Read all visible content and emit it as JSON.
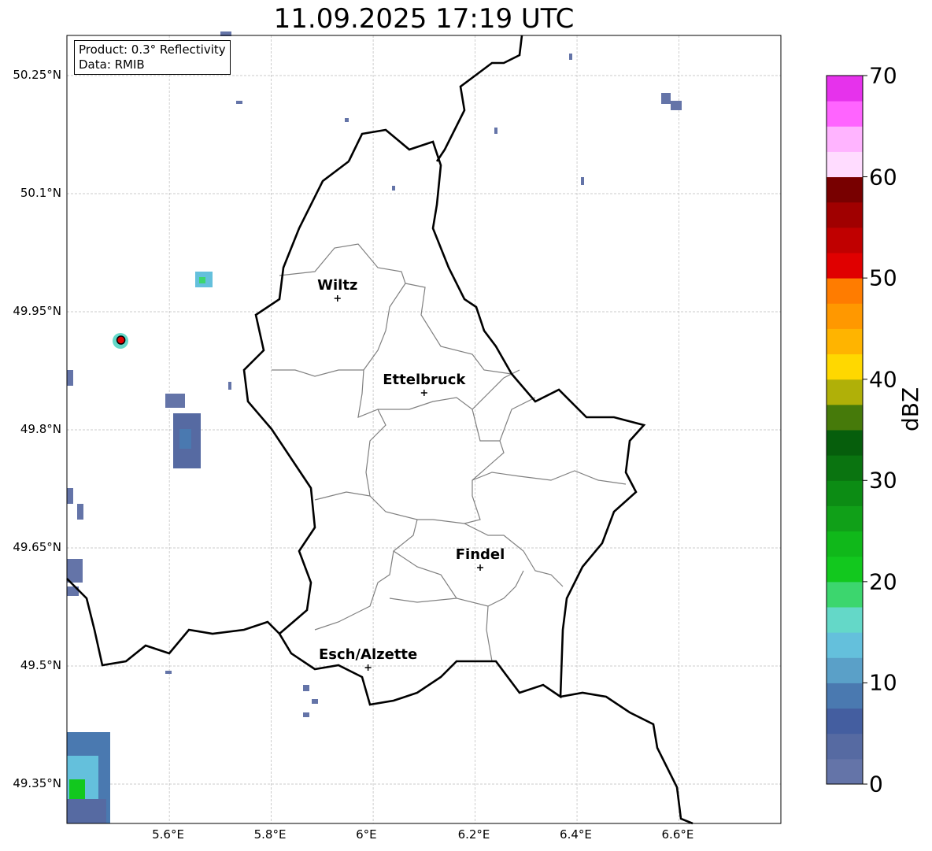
{
  "title": "11.09.2025 17:19 UTC",
  "info": {
    "product": "Product: 0.3° Reflectivity",
    "data": "Data: RMIB"
  },
  "lon_ticks": [
    {
      "v": 5.6,
      "label": "5.6°E"
    },
    {
      "v": 5.8,
      "label": "5.8°E"
    },
    {
      "v": 6.0,
      "label": "6°E"
    },
    {
      "v": 6.2,
      "label": "6.2°E"
    },
    {
      "v": 6.4,
      "label": "6.4°E"
    },
    {
      "v": 6.6,
      "label": "6.6°E"
    }
  ],
  "lat_ticks": [
    {
      "v": 50.25,
      "label": "50.25°N"
    },
    {
      "v": 50.1,
      "label": "50.1°N"
    },
    {
      "v": 49.95,
      "label": "49.95°N"
    },
    {
      "v": 49.8,
      "label": "49.8°N"
    },
    {
      "v": 49.65,
      "label": "49.65°N"
    },
    {
      "v": 49.5,
      "label": "49.5°N"
    },
    {
      "v": 49.35,
      "label": "49.35°N"
    }
  ],
  "extent": {
    "lon": [
      5.399,
      6.8
    ],
    "lat": [
      49.3,
      50.301
    ]
  },
  "cities": [
    {
      "name": "Wiltz",
      "lon": 5.93,
      "lat": 49.967
    },
    {
      "name": "Ettelbruck",
      "lon": 6.1,
      "lat": 49.847
    },
    {
      "name": "Findel",
      "lon": 6.21,
      "lat": 49.625
    },
    {
      "name": "Esch/Alzette",
      "lon": 5.99,
      "lat": 49.498
    }
  ],
  "radar_site": {
    "lon": 5.505,
    "lat": 49.914
  },
  "colorbar": {
    "label": "dBZ",
    "min": 0,
    "max": 70,
    "ticks": [
      "0",
      "10",
      "20",
      "30",
      "40",
      "50",
      "60",
      "70"
    ],
    "colors": [
      "#6474a8",
      "#566aa2",
      "#445ea0",
      "#4a79b0",
      "#5aa0c8",
      "#64c0dc",
      "#64d8c8",
      "#3cd66e",
      "#12c81e",
      "#10b81a",
      "#10a018",
      "#0c8c14",
      "#0a7410",
      "#065e0c",
      "#467a0a",
      "#b0b008",
      "#ffd800",
      "#ffb400",
      "#ff9800",
      "#ff7c00",
      "#e00000",
      "#c00000",
      "#a00000",
      "#780000",
      "#ffdcff",
      "#ffb4ff",
      "#ff64ff",
      "#e632ec"
    ]
  }
}
